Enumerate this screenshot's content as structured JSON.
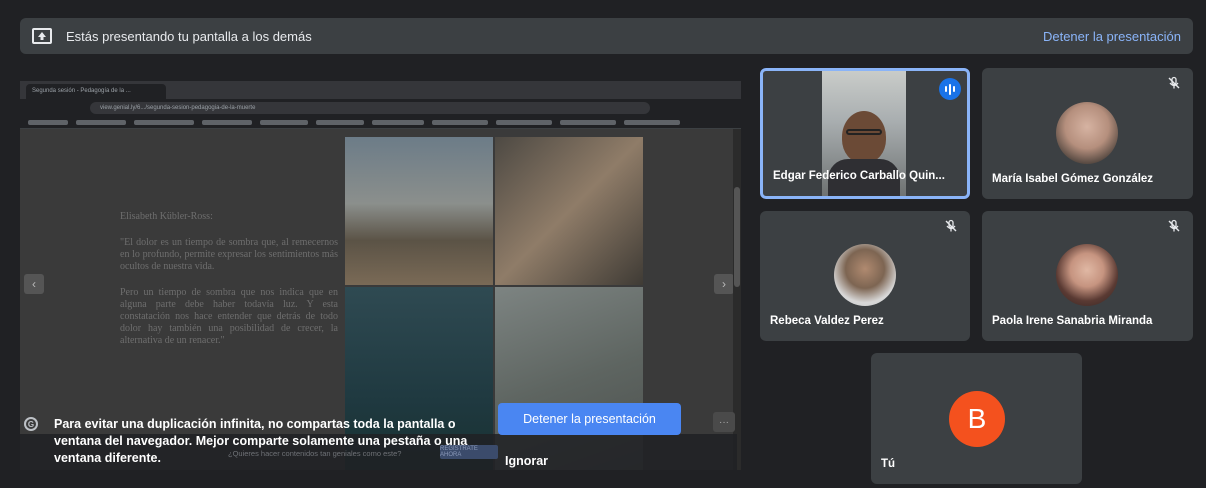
{
  "banner": {
    "text": "Estás presentando tu pantalla a los demás",
    "stop_link": "Detener la presentación"
  },
  "preview": {
    "tab_title": "Segunda sesión - Pedagogía de la ...",
    "address": "view.genial.ly/6.../segunda-sesion-pedagogia-de-la-muerte",
    "doc_author": "Elisabeth Kübler-Ross:",
    "doc_para1": "\"El dolor es un tiempo de sombra que, al remecernos en lo profundo, permite expresar los sentimientos más ocultos de nuestra vida.",
    "doc_para2": "Pero un tiempo de sombra que nos indica que en alguna parte debe haber todavía luz. Y esta constatación nos hace entender que detrás de todo dolor hay también una posibilidad de crecer, la alternativa de un renacer.\"",
    "promo_text": "¿Quieres hacer contenidos tan geniales como este?",
    "promo_button": "REGÍSTRATE AHORA"
  },
  "warning": {
    "text": "Para evitar una duplicación infinita, no compartas toda la pantalla o ventana del navegador. Mejor comparte solamente una pestaña o una ventana diferente.",
    "stop_button": "Detener la presentación",
    "ignore_button": "Ignorar"
  },
  "participants": [
    {
      "name": "Edgar Federico Carballo Quin...",
      "speaking": true,
      "muted": false
    },
    {
      "name": "María Isabel Gómez González",
      "speaking": false,
      "muted": true
    },
    {
      "name": "Rebeca Valdez Perez",
      "speaking": false,
      "muted": true
    },
    {
      "name": "Paola Irene Sanabria Miranda",
      "speaking": false,
      "muted": true
    },
    {
      "name": "Tú",
      "avatar_letter": "B",
      "avatar_color": "#f4511e"
    }
  ],
  "colors": {
    "background": "#202124",
    "tile": "#3c4043",
    "accent": "#8ab4f8",
    "button_blue": "#4a86f2"
  }
}
